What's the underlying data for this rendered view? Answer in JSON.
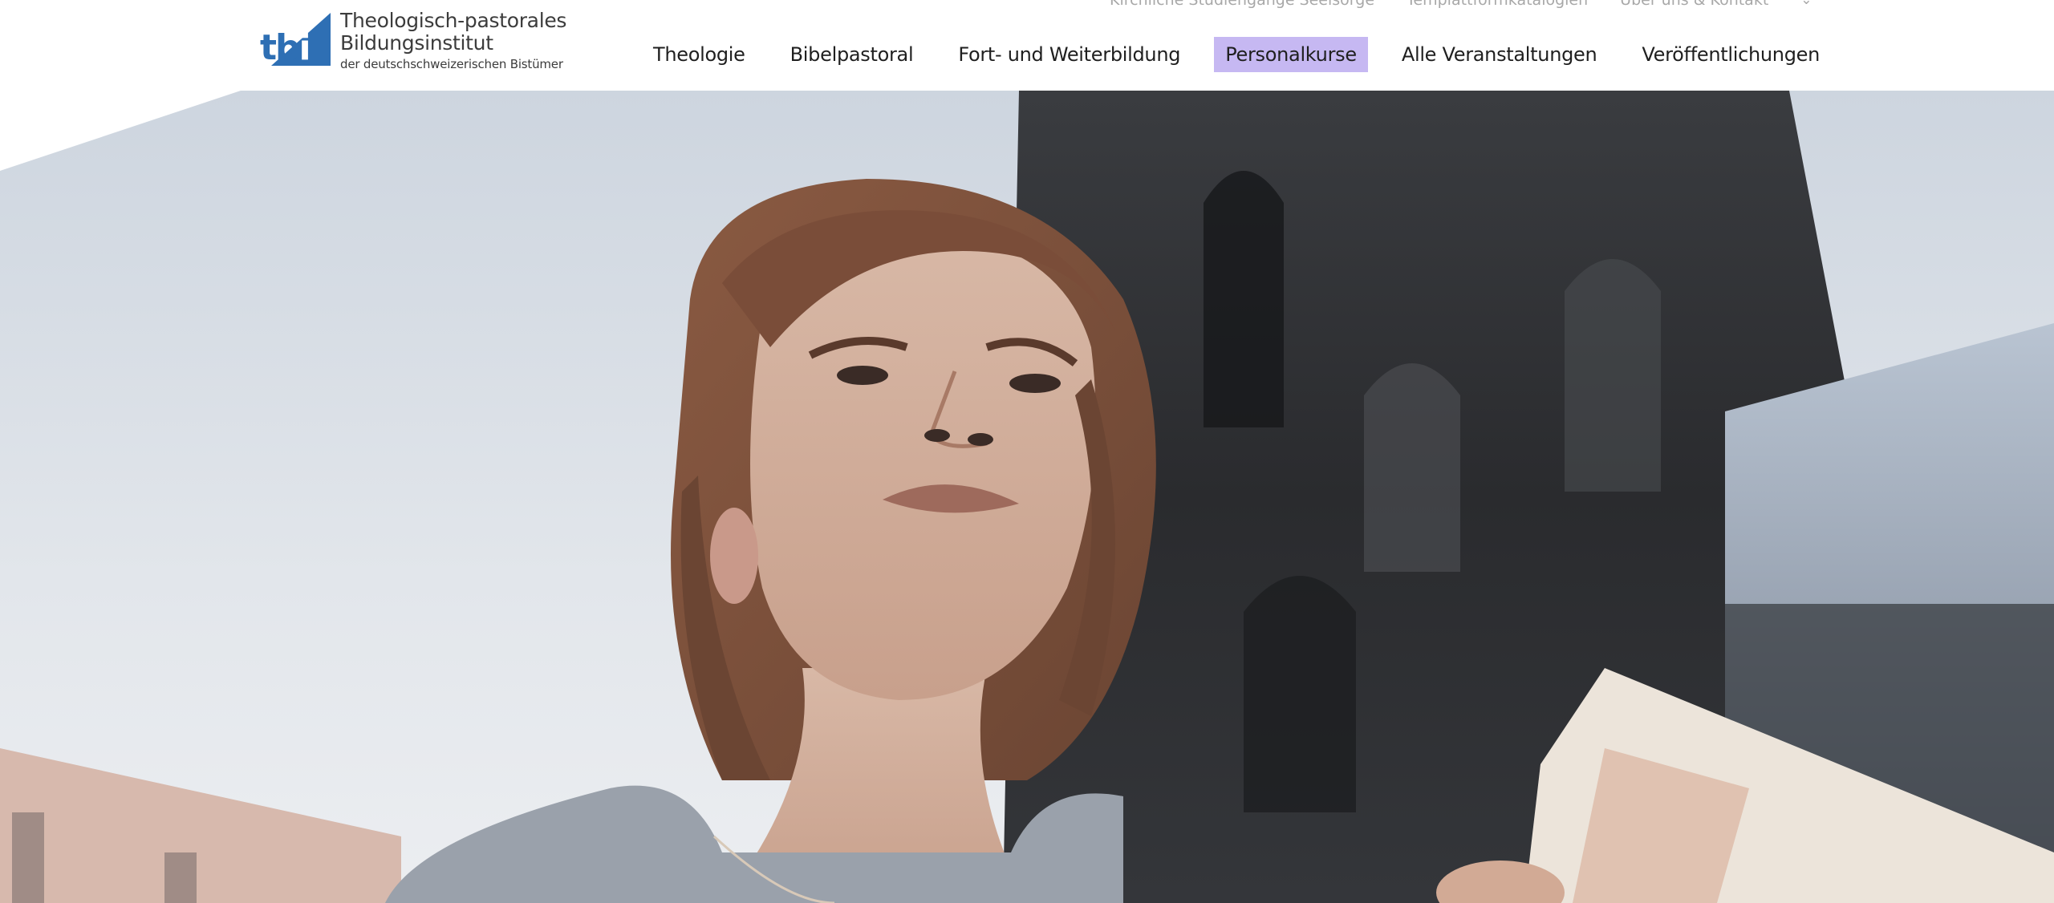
{
  "utility_nav": {
    "items": [
      "Kirchliche Studiengänge Seelsorge",
      "Templattformkatalogien",
      "Über uns & Kontakt"
    ],
    "chevron_icon": "chevron-down-icon"
  },
  "logo": {
    "mark_letters_a": "tb",
    "mark_letters_b": "i",
    "line1": "Theologisch-pastorales",
    "line2": "Bildungsinstitut",
    "line3": "der deutschschweizerischen Bistümer",
    "brand_color": "#2e6fb4"
  },
  "main_nav": {
    "items": [
      {
        "label": "Theologie",
        "active": false
      },
      {
        "label": "Bibelpastoral",
        "active": false
      },
      {
        "label": "Fort- und Weiterbildung",
        "active": false
      },
      {
        "label": "Personalkurse",
        "active": true
      },
      {
        "label": "Alle Veranstaltungen",
        "active": false
      },
      {
        "label": "Veröffentlichungen",
        "active": false
      }
    ],
    "active_color": "#c6b8f2"
  },
  "hero": {
    "image_description_icon": "hero-photo"
  }
}
